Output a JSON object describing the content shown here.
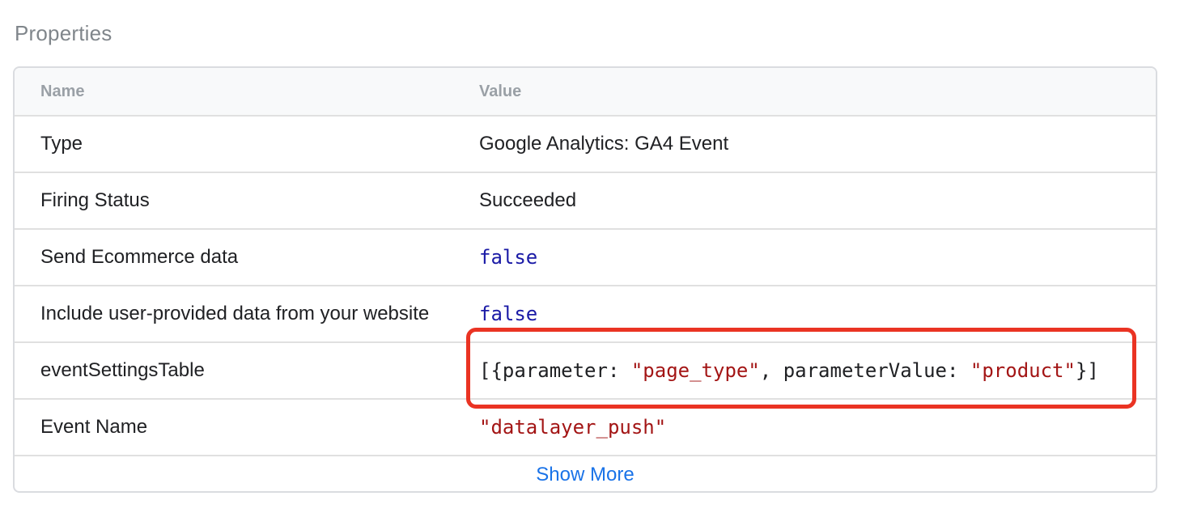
{
  "section": {
    "title": "Properties"
  },
  "table": {
    "headers": {
      "name": "Name",
      "value": "Value"
    },
    "rows": [
      {
        "name": "Type",
        "value": "Google Analytics: GA4 Event"
      },
      {
        "name": "Firing Status",
        "value": "Succeeded"
      },
      {
        "name": "Send Ecommerce data",
        "value": "false"
      },
      {
        "name": "Include user-provided data from your website",
        "value": "false"
      },
      {
        "name": "eventSettingsTable",
        "value": {
          "p1": "[{parameter: ",
          "s1": "\"page_type\"",
          "p2": ", parameterValue: ",
          "s2": "\"product\"",
          "p3": "}]"
        }
      },
      {
        "name": "Event Name",
        "value": "\"datalayer_push\""
      }
    ],
    "show_more_label": "Show More"
  },
  "colors": {
    "keyword": "#1a1aa6",
    "string": "#a31515",
    "link": "#1a73e8",
    "highlight": "#ea3323"
  }
}
